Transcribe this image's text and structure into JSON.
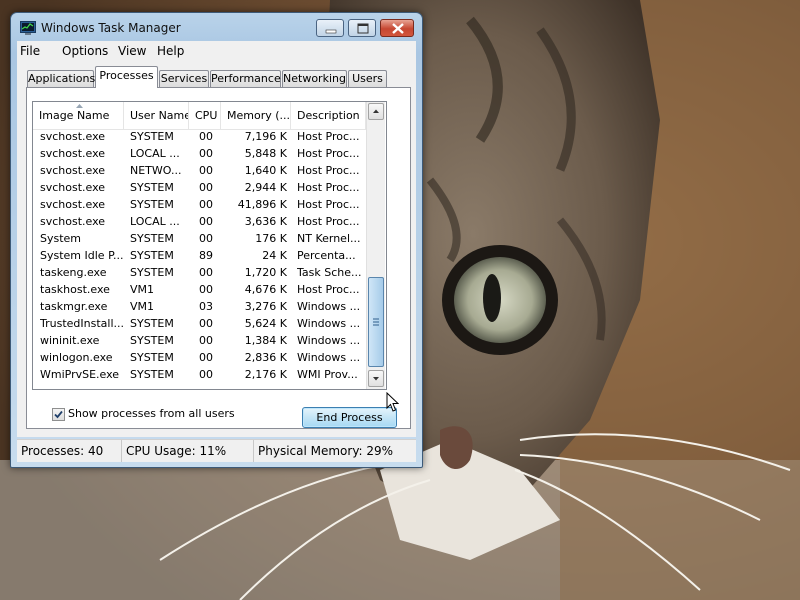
{
  "window": {
    "title": "Windows Task Manager"
  },
  "menu": [
    "File",
    "Options",
    "View",
    "Help"
  ],
  "tabs": [
    "Applications",
    "Processes",
    "Services",
    "Performance",
    "Networking",
    "Users"
  ],
  "active_tab": "Processes",
  "columns": [
    "Image Name",
    "User Name",
    "CPU",
    "Memory (...",
    "Description"
  ],
  "processes": [
    [
      "svchost.exe",
      "SYSTEM",
      "00",
      "7,196 K",
      "Host Proc..."
    ],
    [
      "svchost.exe",
      "LOCAL ...",
      "00",
      "5,848 K",
      "Host Proc..."
    ],
    [
      "svchost.exe",
      "NETWO...",
      "00",
      "1,640 K",
      "Host Proc..."
    ],
    [
      "svchost.exe",
      "SYSTEM",
      "00",
      "2,944 K",
      "Host Proc..."
    ],
    [
      "svchost.exe",
      "SYSTEM",
      "00",
      "41,896 K",
      "Host Proc..."
    ],
    [
      "svchost.exe",
      "LOCAL ...",
      "00",
      "3,636 K",
      "Host Proc..."
    ],
    [
      "System",
      "SYSTEM",
      "00",
      "176 K",
      "NT Kernel..."
    ],
    [
      "System Idle P...",
      "SYSTEM",
      "89",
      "24 K",
      "Percenta..."
    ],
    [
      "taskeng.exe",
      "SYSTEM",
      "00",
      "1,720 K",
      "Task Sche..."
    ],
    [
      "taskhost.exe",
      "VM1",
      "00",
      "4,676 K",
      "Host Proc..."
    ],
    [
      "taskmgr.exe",
      "VM1",
      "03",
      "3,276 K",
      "Windows ..."
    ],
    [
      "TrustedInstall...",
      "SYSTEM",
      "00",
      "5,624 K",
      "Windows ..."
    ],
    [
      "wininit.exe",
      "SYSTEM",
      "00",
      "1,384 K",
      "Windows ..."
    ],
    [
      "winlogon.exe",
      "SYSTEM",
      "00",
      "2,836 K",
      "Windows ..."
    ],
    [
      "WmiPrvSE.exe",
      "SYSTEM",
      "00",
      "2,176 K",
      "WMI Prov..."
    ]
  ],
  "show_all_users": {
    "label": "Show processes from all users",
    "checked": true
  },
  "end_process_label": "End Process",
  "status": {
    "processes": "Processes: 40",
    "cpu": "CPU Usage: 11%",
    "memory": "Physical Memory: 29%"
  },
  "icons": [
    "task-manager-icon",
    "minimize-icon",
    "maximize-icon",
    "close-icon",
    "sort-ascending-icon",
    "scroll-up-icon",
    "scroll-down-icon",
    "checkmark-icon",
    "mouse-pointer-icon"
  ]
}
